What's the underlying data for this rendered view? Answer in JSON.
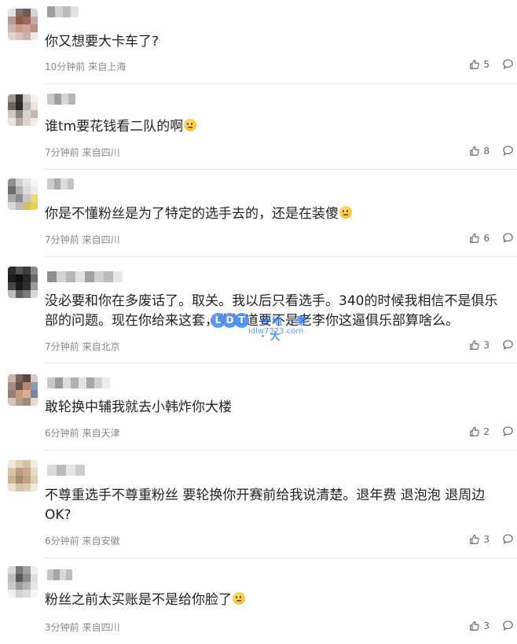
{
  "comments": [
    {
      "text": "你又想要大卡车了?",
      "emoji": false,
      "time": "10分钟前",
      "location": "来自上海",
      "likes": "5"
    },
    {
      "text": "谁tm要花钱看二队的啊",
      "emoji": true,
      "time": "7分钟前",
      "location": "来自四川",
      "likes": "8"
    },
    {
      "text": "你是不懂粉丝是为了特定的选手去的，还是在装傻",
      "emoji": true,
      "time": "7分钟前",
      "location": "来自四川",
      "likes": "6"
    },
    {
      "text": "没必要和你在多废话了。取关。我以后只看选手。340的时候我相信不是俱乐部的问题。现在你给来这套，你知道要不是老李你这逼俱乐部算啥么。",
      "emoji": false,
      "time": "7分钟前",
      "location": "来自北京",
      "likes": "3"
    },
    {
      "text": "敢轮换中辅我就去小韩炸你大楼",
      "emoji": false,
      "time": "6分钟前",
      "location": "来自天津",
      "likes": "2"
    },
    {
      "text": "不尊重选手不尊重粉丝 要轮换你开赛前给我说清楚。退年费 退泡泡 退周边OK?",
      "emoji": false,
      "time": "6分钟前",
      "location": "来自安徽",
      "likes": "3"
    },
    {
      "text": "粉丝之前太买账是不是给你脸了",
      "emoji": true,
      "time": "3分钟前",
      "location": "来自四川",
      "likes": "3"
    }
  ],
  "watermark": {
    "letters": [
      "L",
      "D",
      "T"
    ],
    "name": "天地 · 聚 · 大",
    "url": "ldlw7373.com"
  },
  "colors": {
    "text": "#222222",
    "meta": "#888888",
    "divider": "#ececec",
    "watermark": "#3b82f0"
  }
}
